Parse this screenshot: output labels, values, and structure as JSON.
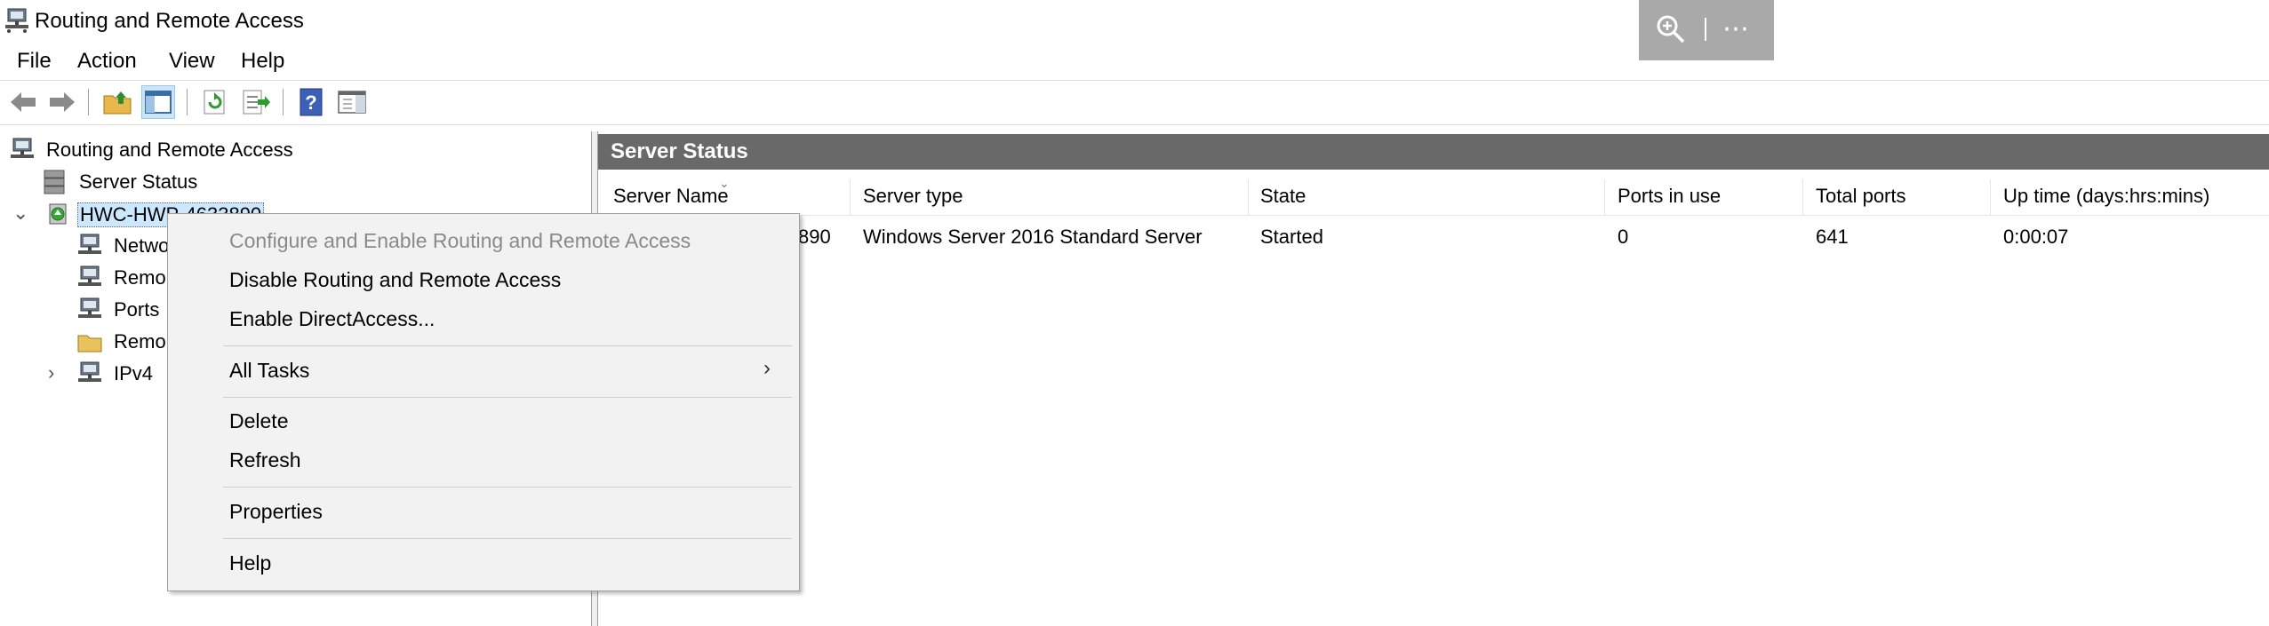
{
  "window": {
    "title": "Routing and Remote Access"
  },
  "menubar": {
    "items": [
      "File",
      "Action",
      "View",
      "Help"
    ]
  },
  "toolbar": {
    "buttons": [
      "back-icon",
      "forward-icon",
      "up-folder-icon",
      "show-hide-console-tree-icon",
      "refresh-icon",
      "export-list-icon",
      "help-icon",
      "show-hide-action-pane-icon"
    ]
  },
  "tree": {
    "root": "Routing and Remote Access",
    "server_status": "Server Status",
    "server": "HWC-HWP-4633890",
    "children": [
      "Netwo",
      "Remo",
      "Ports",
      "Remo",
      "IPv4"
    ]
  },
  "pane": {
    "title": "Server Status",
    "columns": [
      "Server Name",
      "Server type",
      "State",
      "Ports in use",
      "Total ports",
      "Up time (days:hrs:mins)"
    ],
    "rows": [
      {
        "name": "890",
        "type": "Windows Server 2016 Standard Server",
        "state": "Started",
        "ports_in_use": "0",
        "total_ports": "641",
        "uptime": "0:00:07"
      }
    ]
  },
  "context_menu": {
    "configure": "Configure and Enable Routing and Remote Access",
    "disable": "Disable Routing and Remote Access",
    "enable_da": "Enable DirectAccess...",
    "all_tasks": "All Tasks",
    "delete": "Delete",
    "refresh": "Refresh",
    "properties": "Properties",
    "help": "Help"
  },
  "colors": {
    "header_bg": "#696969",
    "selection": "#cce8ff",
    "menu_bg": "#f2f2f2",
    "zoom_bar": "#a9a9a9"
  }
}
